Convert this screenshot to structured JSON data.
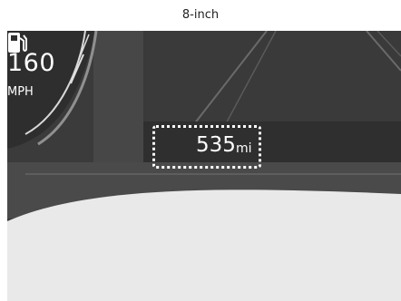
{
  "caption": "8-inch",
  "speedometer": {
    "value": "160",
    "unit": "MPH"
  },
  "range_display": {
    "value": "535",
    "unit": "mi",
    "icon": "fuel-pump-icon"
  },
  "colors": {
    "cluster_dark": "#3e3e3e",
    "cluster_mid": "#4b4b4b",
    "highlight_text": "#ffffff",
    "background_light": "#e9e9e9"
  }
}
